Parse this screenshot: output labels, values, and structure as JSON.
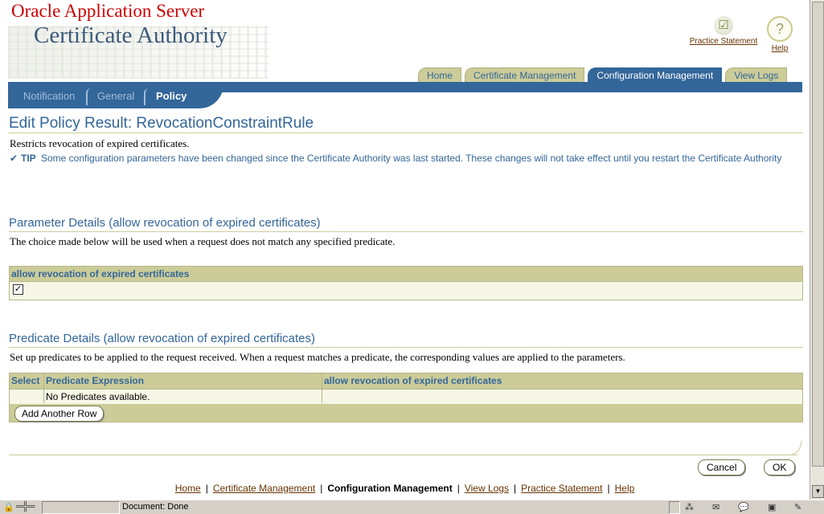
{
  "header": {
    "brand_company": "Oracle Application Server",
    "brand_product": "Certificate Authority",
    "global_links": {
      "practice_statement": "Practice Statement",
      "help": "Help"
    }
  },
  "tabs": [
    {
      "label": "Home",
      "active": false
    },
    {
      "label": "Certificate Management",
      "active": false
    },
    {
      "label": "Configuration Management",
      "active": true
    },
    {
      "label": "View Logs",
      "active": false
    }
  ],
  "subnav": [
    {
      "label": "Notification",
      "active": false
    },
    {
      "label": "General",
      "active": false
    },
    {
      "label": "Policy",
      "active": true
    }
  ],
  "main": {
    "title": "Edit Policy Result: RevocationConstraintRule",
    "description": "Restricts revocation of expired certificates.",
    "tip_label": "TIP",
    "tip_text": "Some configuration parameters have been changed since the Certificate Authority was last started. These changes will not take effect until you restart the Certificate Authority"
  },
  "parameter_details": {
    "title": "Parameter Details (allow revocation of expired certificates)",
    "description": "The choice made below will be used when a request does not match any specified predicate.",
    "column_header": "allow revocation of expired certificates",
    "checkbox_checked": true,
    "checkbox_glyph": "✓"
  },
  "predicate_details": {
    "title": "Predicate Details (allow revocation of expired certificates)",
    "description": "Set up predicates to be applied to the request received. When a request matches a predicate, the corresponding values are applied to the parameters.",
    "columns": [
      "Select",
      "Predicate Expression",
      "allow revocation of expired certificates"
    ],
    "empty_message": "No Predicates available.",
    "add_row_label": "Add Another Row"
  },
  "actions": {
    "cancel_label": "Cancel",
    "ok_label": "OK"
  },
  "footer": {
    "links": [
      "Home",
      "Certificate Management",
      "Configuration Management",
      "View Logs",
      "Practice Statement",
      "Help"
    ],
    "separator": "|"
  },
  "statusbar": {
    "text": "Document: Done"
  },
  "colors": {
    "accent": "#336699",
    "tab_inactive": "#cccc99",
    "brand_red": "#cc0000",
    "link": "#663300"
  }
}
